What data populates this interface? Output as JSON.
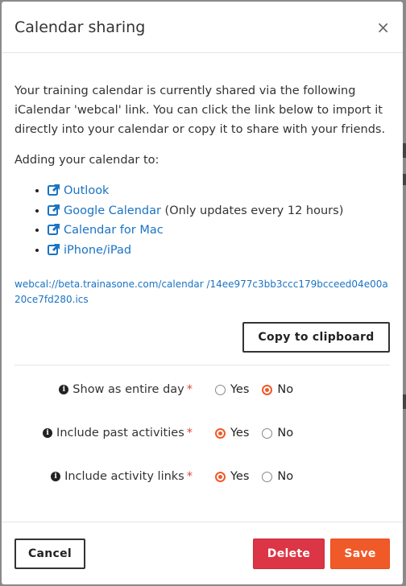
{
  "modal": {
    "title": "Calendar sharing",
    "close_label": "×",
    "intro": "Your training calendar is currently shared via the following iCalendar 'webcal' link. You can click the link below to import it directly into your calendar or copy it to share with your friends.",
    "adding_label": "Adding your calendar to:",
    "links": [
      {
        "label": "Outlook",
        "note": ""
      },
      {
        "label": "Google Calendar",
        "note": " (Only updates every 12 hours)"
      },
      {
        "label": "Calendar for Mac",
        "note": ""
      },
      {
        "label": "iPhone/iPad",
        "note": ""
      }
    ],
    "webcal_url": "webcal://beta.trainasone.com/calendar /14ee977c3bb3ccc179bcceed04e00a20ce7fd280.ics",
    "copy_button": "Copy to clipboard",
    "settings": [
      {
        "label": "Show as entire day",
        "required": "*",
        "yes": "Yes",
        "no": "No",
        "selected": "No"
      },
      {
        "label": "Include past activities",
        "required": "*",
        "yes": "Yes",
        "no": "No",
        "selected": "Yes"
      },
      {
        "label": "Include activity links",
        "required": "*",
        "yes": "Yes",
        "no": "No",
        "selected": "Yes"
      }
    ],
    "footer": {
      "cancel": "Cancel",
      "delete": "Delete",
      "save": "Save"
    }
  },
  "colors": {
    "accent": "#f05a28",
    "danger": "#dc3545",
    "link": "#1a73c4"
  }
}
